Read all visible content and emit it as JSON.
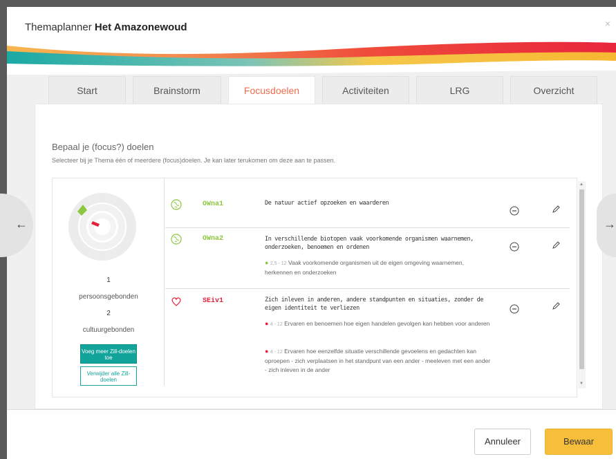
{
  "modal": {
    "title_prefix": "Themaplanner",
    "title_name": "Het Amazonewoud",
    "close_label": "×"
  },
  "tabs": [
    {
      "label": "Start"
    },
    {
      "label": "Brainstorm"
    },
    {
      "label": "Focusdoelen"
    },
    {
      "label": "Activiteiten"
    },
    {
      "label": "LRG"
    },
    {
      "label": "Overzicht"
    }
  ],
  "active_tab": "Focusdoelen",
  "panel": {
    "heading": "Bepaal je (focus?) doelen",
    "subheading": "Selecteer bij je Thema één of meerdere (focus)doelen. Je kan later terukomen om deze aan te passen."
  },
  "summary": {
    "count1": "1",
    "label1": "persoonsgebonden",
    "count2": "2",
    "label2": "cultuurgebonden",
    "add_button": "Voeg meer Zill-doelen toe",
    "remove_button": "Verwijder alle Zill-doelen"
  },
  "goals": [
    {
      "icon": "globe-icon",
      "code": "OWna1",
      "title": "De natuur actief opzoeken en waarderen",
      "subgoals": []
    },
    {
      "icon": "globe-icon",
      "code": "OWna2",
      "title": "In verschillende biotopen vaak voorkomende organismen waarnemen, onderzoeken, benoemen en ordenen",
      "subgoals": [
        {
          "range": "2,5 - 12",
          "text": "Vaak voorkomende organismen uit de eigen omgeving waarnemen, herkennen en onderzoeken"
        }
      ]
    },
    {
      "icon": "heart-icon",
      "code": "SEiv1",
      "title": "Zich inleven in anderen, andere standpunten en situaties, zonder de eigen identiteit te verliezen",
      "subgoals": [
        {
          "range": "4 - 12",
          "text": "Ervaren en benoemen hoe eigen handelen gevolgen kan hebben voor anderen"
        },
        {
          "range": "4 - 12",
          "text": "Ervaren hoe eenzelfde situatie verschillende gevoelens en gedachten kan oproepen - zich verplaatsen in het standpunt van een ander - meeleven met een ander - zich inleven in de ander"
        }
      ]
    }
  ],
  "footer": {
    "cancel": "Annuleer",
    "save": "Bewaar"
  },
  "nav": {
    "prev_glyph": "←",
    "next_glyph": "→"
  },
  "colors": {
    "accent_orange": "#f26c4f",
    "teal": "#12a39a",
    "save_yellow": "#f7be3b",
    "green": "#8dc63f",
    "red": "#e2213c"
  }
}
